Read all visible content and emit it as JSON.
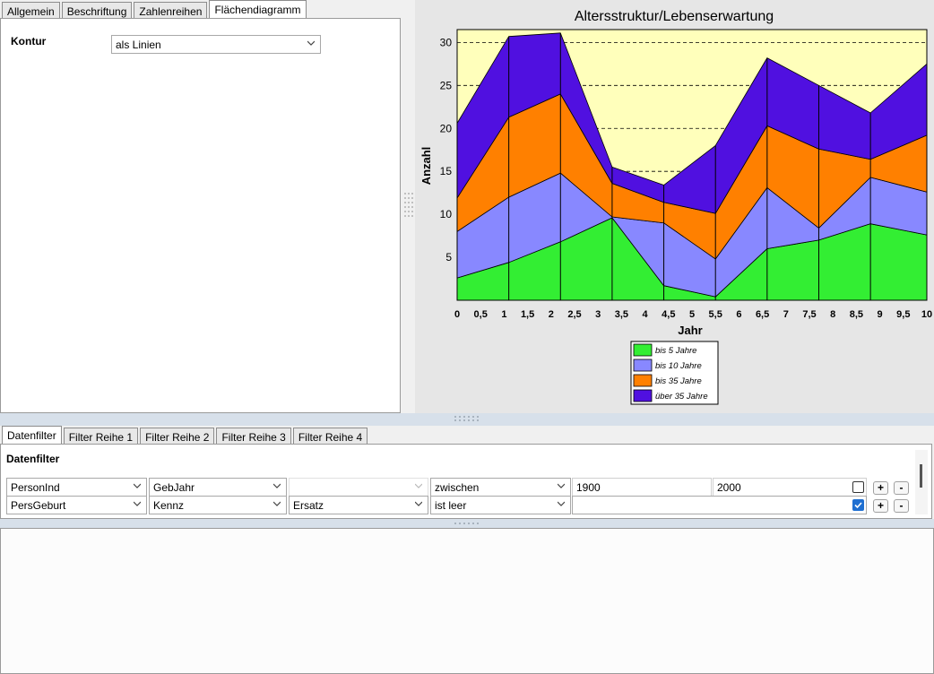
{
  "top_tabs": [
    "Allgemein",
    "Beschriftung",
    "Zahlenreihen",
    "Flächendiagramm"
  ],
  "top_active_tab": 3,
  "settings": {
    "kontur_label": "Kontur",
    "kontur_value": "als Linien"
  },
  "chart_data": {
    "type": "area",
    "stacked": true,
    "title": "Altersstruktur/Lebenserwartung",
    "xlabel": "Jahr",
    "ylabel": "Anzahl",
    "x_ticks": [
      "0",
      "0,5",
      "1",
      "1,5",
      "2",
      "2,5",
      "3",
      "3,5",
      "4",
      "4,5",
      "5",
      "5,5",
      "6",
      "6,5",
      "7",
      "7,5",
      "8",
      "8,5",
      "9",
      "9,5",
      "10"
    ],
    "y_ticks": [
      5,
      10,
      15,
      20,
      25,
      30
    ],
    "xlim": [
      0,
      10
    ],
    "ylim": [
      0,
      31.5
    ],
    "grid": "horizontal dashed",
    "x": [
      0,
      1.1,
      2.2,
      3.3,
      4.4,
      5.5,
      6.6,
      7.7,
      8.8,
      10
    ],
    "series": [
      {
        "name": "bis 5 Jahre",
        "color": "#33ee33",
        "values": [
          2.6,
          4.4,
          6.8,
          9.6,
          1.7,
          0.4,
          6.0,
          7.0,
          8.9,
          7.6
        ]
      },
      {
        "name": "bis 10 Jahre",
        "color": "#8888ff",
        "values": [
          5.4,
          7.6,
          8.0,
          0.1,
          7.3,
          4.4,
          7.1,
          1.4,
          5.4,
          5.0
        ]
      },
      {
        "name": "bis 35 Jahre",
        "color": "#ff8000",
        "values": [
          3.9,
          9.3,
          9.2,
          3.9,
          2.4,
          5.3,
          7.2,
          9.2,
          2.1,
          6.6
        ]
      },
      {
        "name": "über 35 Jahre",
        "color": "#5010e0",
        "values": [
          8.7,
          9.4,
          7.1,
          1.9,
          2.0,
          7.9,
          7.9,
          7.4,
          5.4,
          8.3
        ]
      }
    ],
    "plot_background": "#ffffbb",
    "legend_position": "bottom"
  },
  "bottom_tabs": [
    "Datenfilter",
    "Filter Reihe 1",
    "Filter Reihe 2",
    "Filter Reihe 3",
    "Filter Reihe 4"
  ],
  "bottom_active_tab": 0,
  "filter": {
    "heading": "Datenfilter",
    "rows": [
      {
        "field1": "PersonInd",
        "field2": "GebJahr",
        "field3": "",
        "operator": "zwischen",
        "value1": "1900",
        "value2": "2000",
        "checked": false
      },
      {
        "field1": "PersGeburt",
        "field2": "Kennz",
        "field3": "Ersatz",
        "operator": "ist leer",
        "value1": "",
        "value2": "",
        "checked": true
      }
    ],
    "plus": "+",
    "minus": "-"
  }
}
